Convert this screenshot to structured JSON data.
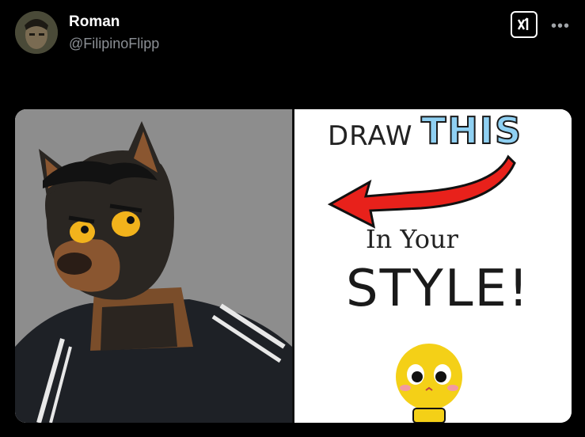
{
  "post": {
    "author_name": "Roman",
    "author_handle": "@FilipinoFlipp"
  },
  "icons": {
    "x_logo": "x-logo-icon",
    "more": "more-options-icon"
  },
  "media": {
    "meme_text": {
      "draw": "DRAW",
      "this": "THIS",
      "in_your": "In Your",
      "style": "STYLE!"
    }
  }
}
